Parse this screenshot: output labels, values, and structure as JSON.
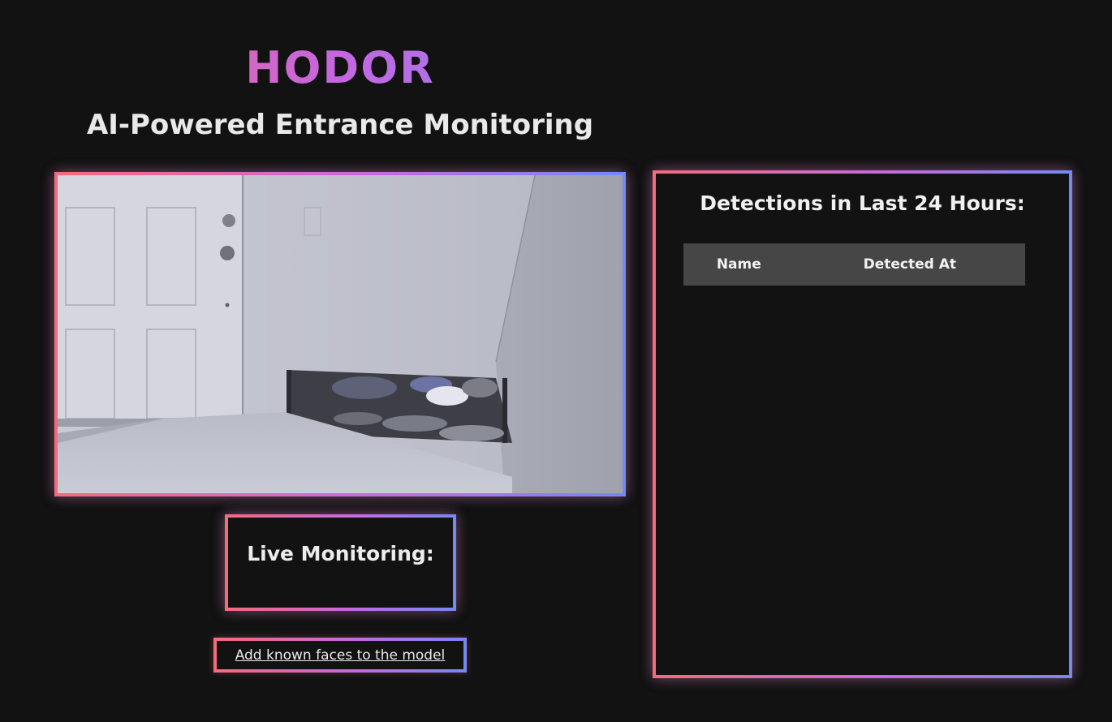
{
  "header": {
    "title": "HODOR",
    "subtitle": "AI-Powered Entrance Monitoring"
  },
  "live": {
    "label": "Live Monitoring:"
  },
  "links": {
    "add_faces": "Add known faces to the model"
  },
  "detections": {
    "title": "Detections in Last 24 Hours:",
    "columns": [
      "Name",
      "Detected At"
    ],
    "rows": []
  },
  "colors": {
    "background": "#121212",
    "gradient_start": "#f56b78",
    "gradient_mid": "#c869e0",
    "gradient_end": "#7389f3",
    "table_header_bg": "#464646"
  }
}
